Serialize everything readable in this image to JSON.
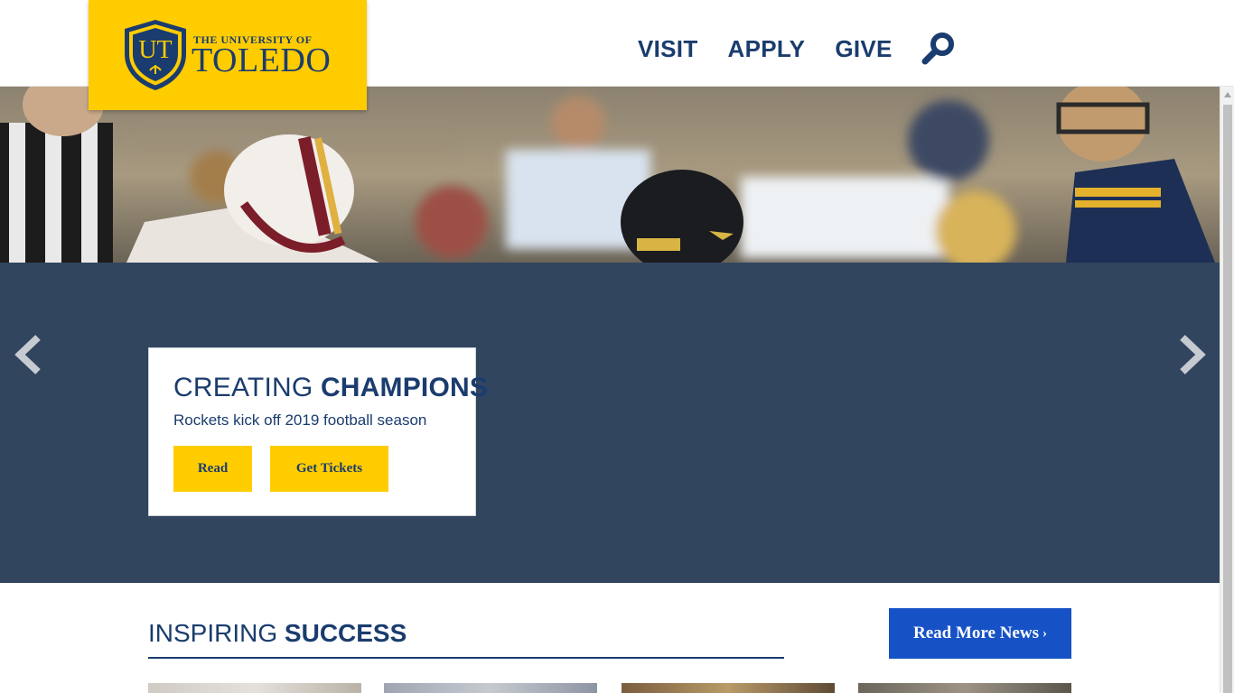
{
  "header": {
    "logo_small": "THE UNIVERSITY OF",
    "logo_big": "TOLEDO",
    "logo_monogram": "UT",
    "nav": [
      {
        "label": "VISIT"
      },
      {
        "label": "APPLY"
      },
      {
        "label": "GIVE"
      }
    ],
    "search_icon": "search-icon"
  },
  "hero": {
    "title_light": "CREATING",
    "title_bold": "CHAMPIONS",
    "subtitle": "Rockets kick off 2019 football season",
    "buttons": {
      "read": "Read",
      "tickets": "Get Tickets"
    },
    "prev_icon": "chevron-left-icon",
    "next_icon": "chevron-right-icon"
  },
  "news": {
    "title_light": "INSPIRING",
    "title_bold": "SUCCESS",
    "read_more": "Read More News",
    "read_more_chevron": "›"
  },
  "colors": {
    "brand_navy": "#1a3c6e",
    "brand_gold": "#ffcc00",
    "panel_blue": "#31455f",
    "button_blue": "#1652c6"
  }
}
